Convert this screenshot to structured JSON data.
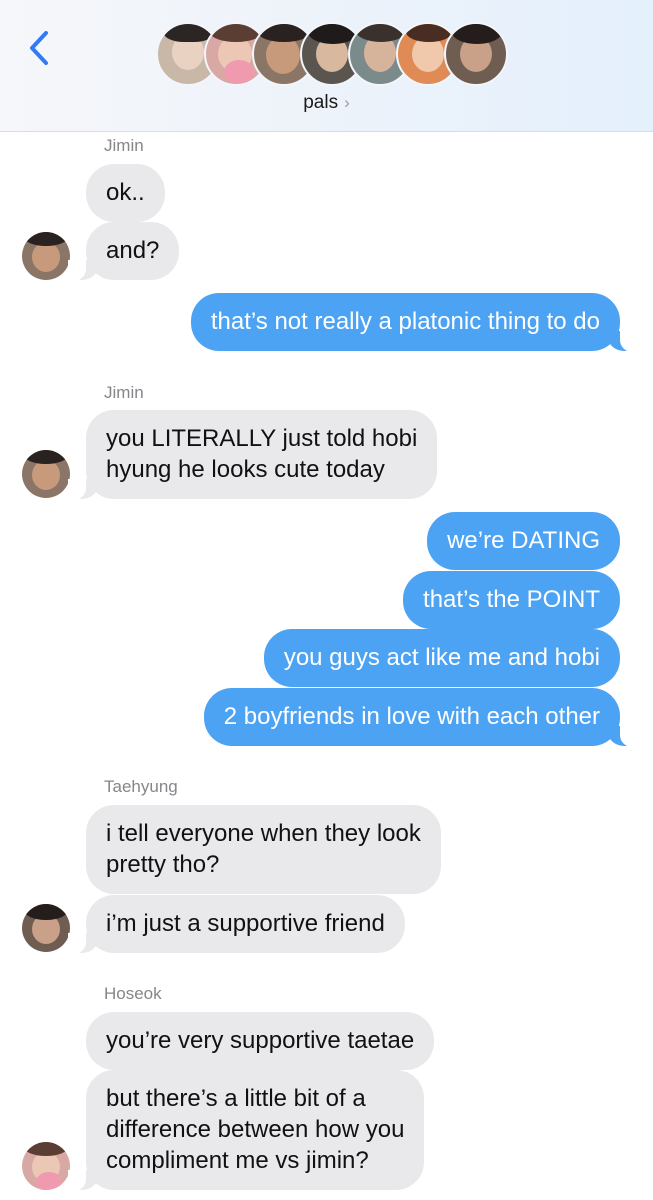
{
  "header": {
    "group_name": "pals",
    "chevron": "›",
    "back_icon": "chevron-left-icon",
    "avatar_colors": [
      "#c9b8a8",
      "#d8a9a4",
      "#8a7566",
      "#5b5550",
      "#7b8a8a",
      "#e08a55",
      "#6f5d52"
    ]
  },
  "colors": {
    "accent": "#2f7cf6",
    "outgoing_bubble": "#4da3f3",
    "incoming_bubble": "#e9e9eb"
  },
  "messages": [
    {
      "sender": "Jimin",
      "text": "ok.."
    },
    {
      "text": "and?"
    },
    {
      "text": "that’s not really a platonic thing to do"
    },
    {
      "sender": "Jimin",
      "line1": "you LITERALLY just told hobi",
      "line2": "hyung he looks cute today"
    },
    {
      "text": "we’re DATING"
    },
    {
      "text": "that’s the POINT"
    },
    {
      "text": "you guys act like me and hobi"
    },
    {
      "text": "2 boyfriends in love with each other"
    },
    {
      "sender": "Taehyung",
      "line1": "i tell everyone when they look",
      "line2": "pretty tho?"
    },
    {
      "text": "i’m just a supportive friend"
    },
    {
      "sender": "Hoseok",
      "text": "you’re very supportive taetae"
    },
    {
      "line1": "but there’s a little bit of a",
      "line2": "difference between how you",
      "line3": "compliment me vs jimin?"
    }
  ]
}
